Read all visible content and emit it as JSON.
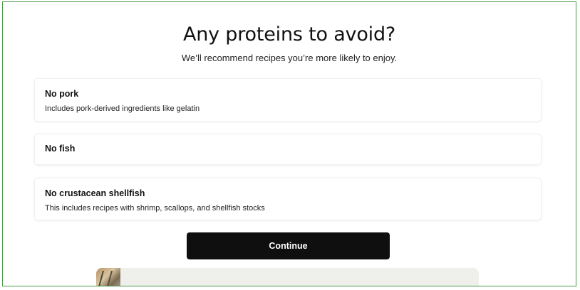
{
  "page": {
    "title": "Any proteins to avoid?",
    "subtitle": "We’ll recommend recipes you’re more likely to enjoy."
  },
  "options": [
    {
      "label": "No pork",
      "description": "Includes pork-derived ingredients like gelatin"
    },
    {
      "label": "No fish",
      "description": ""
    },
    {
      "label": "No crustacean shellfish",
      "description": "This includes recipes with shrimp, scallops, and shellfish stocks"
    }
  ],
  "actions": {
    "continue_label": "Continue"
  },
  "colors": {
    "frame_border": "#4a9a4a",
    "button_bg": "#0f0f0f",
    "button_text": "#ffffff",
    "promo_bg": "#efefeb"
  }
}
